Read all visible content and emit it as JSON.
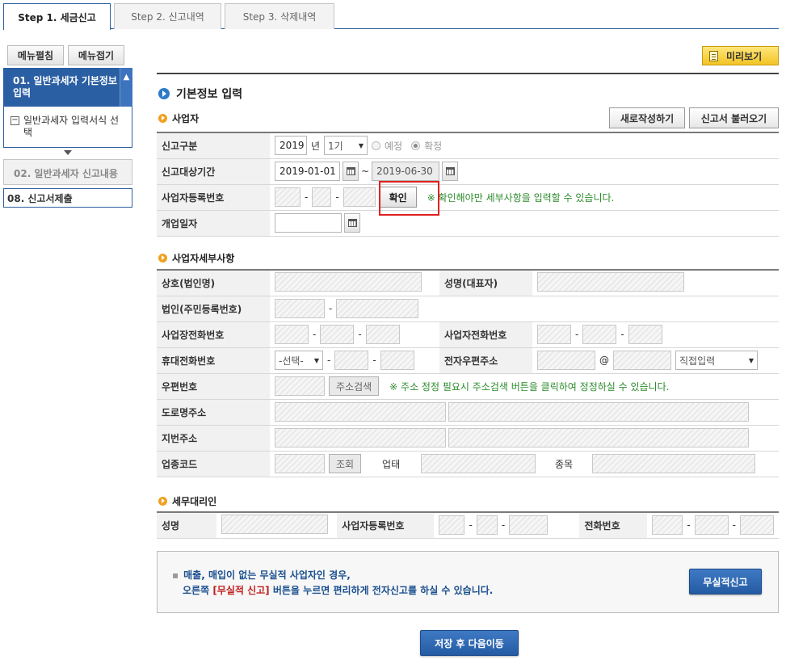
{
  "tabs": [
    {
      "label": "Step 1. 세금신고"
    },
    {
      "label": "Step 2. 신고내역"
    },
    {
      "label": "Step 3. 삭제내역"
    }
  ],
  "sidebar": {
    "expand_label": "메뉴펼침",
    "collapse_label": "메뉴접기",
    "active_item": "01. 일반과세자 기본정보 입력",
    "sub_item": "일반과세자 입력서식 선택",
    "items": [
      "02. 일반과세자 신고내용",
      "08. 신고서제출"
    ]
  },
  "preview_label": "미리보기",
  "main_title": "기본정보 입력",
  "business": {
    "title": "사업자",
    "new_button": "새로작성하기",
    "load_button": "신고서 불러오기",
    "report_type": {
      "label": "신고구분",
      "year": "2019",
      "year_unit": "년",
      "period": "1기",
      "option_planned": "예정",
      "option_confirmed": "확정"
    },
    "report_period": {
      "label": "신고대상기간",
      "start": "2019-01-01",
      "separator": "~",
      "end": "2019-06-30"
    },
    "biz_number": {
      "label": "사업자등록번호",
      "confirm_button": "확인",
      "note": "※ 확인해야만 세부사항을 입력할 수 있습니다."
    },
    "open_date": {
      "label": "개업일자"
    }
  },
  "details": {
    "title": "사업자세부사항",
    "company_name": "상호(법인명)",
    "representative": "성명(대표자)",
    "corp_number": "법인(주민등록번호)",
    "office_phone": "사업장전화번호",
    "biz_phone": "사업자전화번호",
    "mobile": "휴대전화번호",
    "mobile_select": "-선택-",
    "email": "전자우편주소",
    "email_at": "@",
    "email_domain": "직접입력",
    "zip": "우편번호",
    "zip_search": "주소검색",
    "zip_note": "※ 주소 정정 필요시 주소검색 버튼을 클릭하여 정정하실 수 있습니다.",
    "road_address": "도로명주소",
    "lot_address": "지번주소",
    "industry_code": "업종코드",
    "lookup": "조회",
    "business_type": "업태",
    "business_item": "종목"
  },
  "agent": {
    "title": "세무대리인",
    "name": "성명",
    "biz_number": "사업자등록번호",
    "phone": "전화번호"
  },
  "notice": {
    "line1": "매출, 매입이 없는 무실적 사업자인 경우,",
    "line2_pre": "오른쪽 ",
    "line2_highlight": "[무실적 신고]",
    "line2_post": " 버튼을 누르면 편리하게 전자신고를 하실 수 있습니다.",
    "button": "무실적신고"
  },
  "save_button": "저장 후 다음이동",
  "colors": {
    "primary": "#2b5fa3",
    "highlight_box": "#e02020",
    "preview": "#f2c425"
  }
}
